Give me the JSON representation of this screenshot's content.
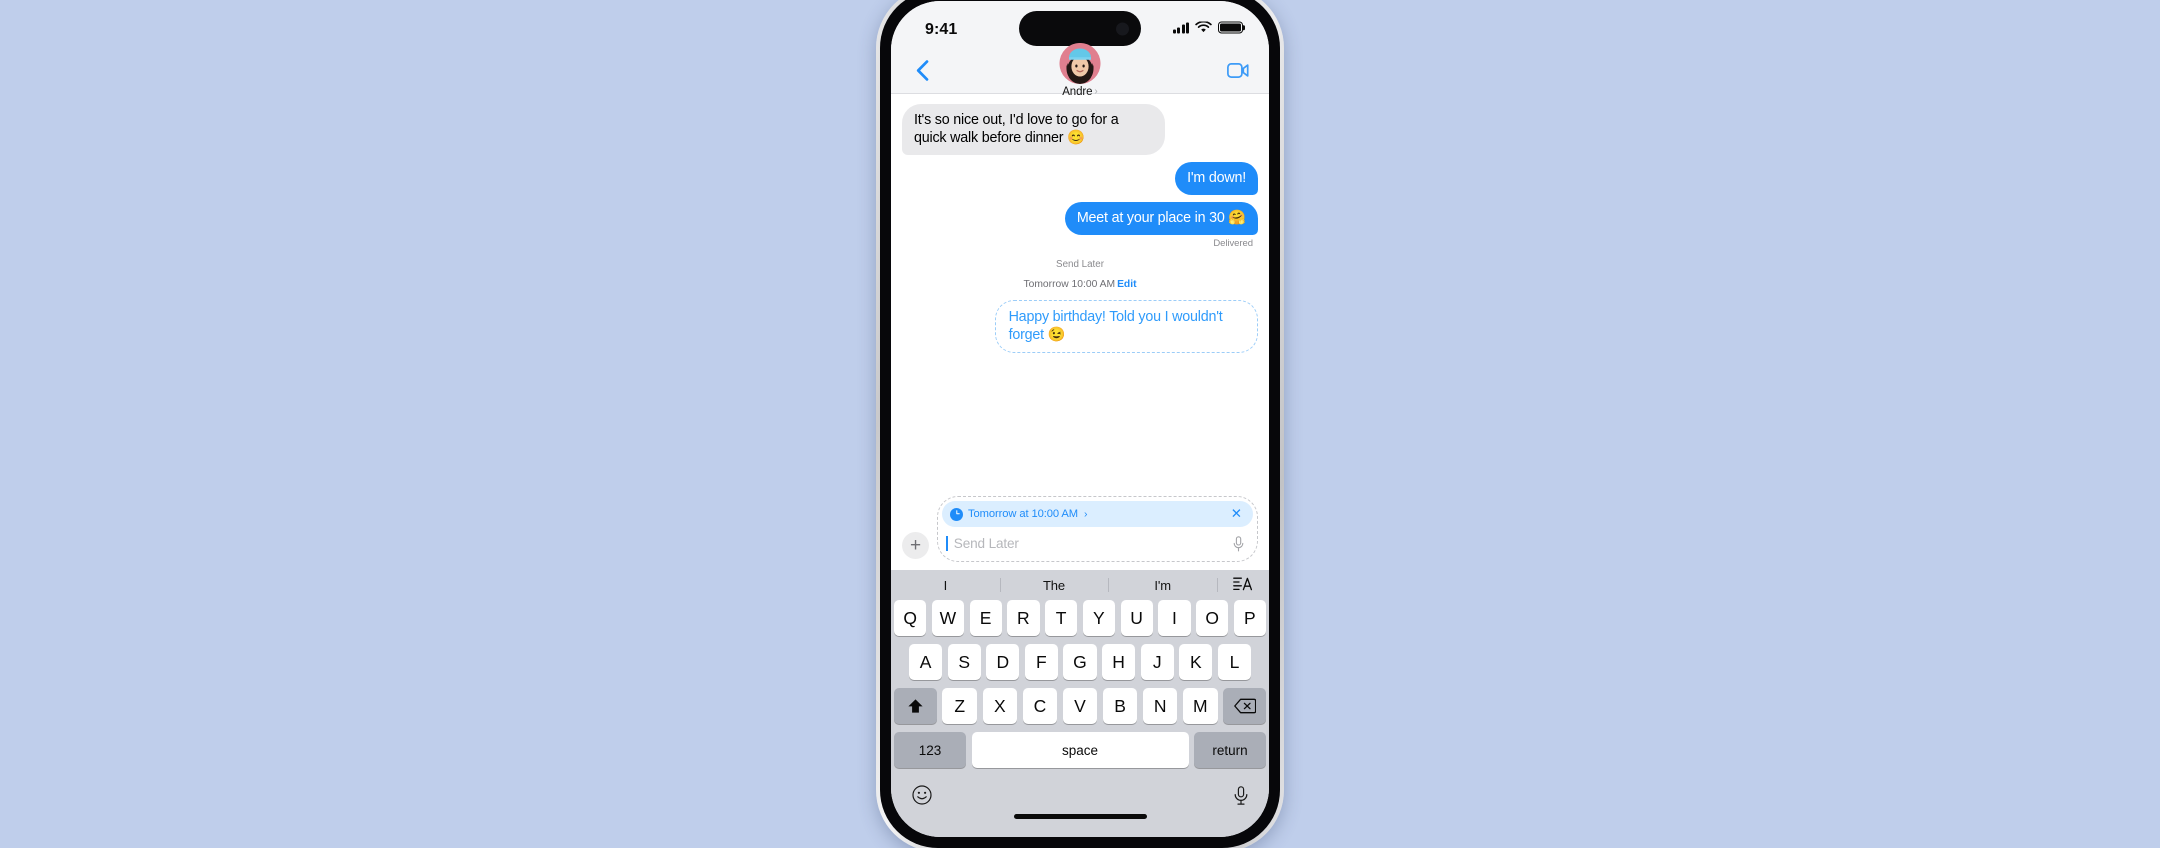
{
  "background_color": "#bfceeb",
  "accent_color": "#1f8cf9",
  "status_bar": {
    "time": "9:41",
    "signal_icon": "cellular-signal-icon",
    "wifi_icon": "wifi-icon",
    "battery_icon": "battery-icon"
  },
  "header": {
    "back_icon": "chevron-left-icon",
    "contact_name": "Andre",
    "contact_chevron": "›",
    "avatar_icon": "contact-avatar",
    "video_icon": "video-camera-icon"
  },
  "messages": [
    {
      "id": "msg-1",
      "direction": "in",
      "text": "It's so nice out, I'd love to go for a quick walk before dinner 😊"
    },
    {
      "id": "msg-2",
      "direction": "out",
      "text": "I'm down!"
    },
    {
      "id": "msg-3",
      "direction": "out",
      "text": "Meet at your place in 30 🤗"
    }
  ],
  "delivery_status": "Delivered",
  "send_later": {
    "title": "Send Later",
    "time": "Tomorrow 10:00 AM",
    "edit_label": "Edit",
    "scheduled_message": "Happy birthday! Told you I wouldn't forget 😉"
  },
  "composer": {
    "plus_icon": "plus-icon",
    "plus_label": "+",
    "chip": {
      "clock_icon": "clock-icon",
      "text": "Tomorrow at 10:00 AM",
      "chevron": "›",
      "close_label": "✕",
      "close_icon": "close-icon",
      "background": "#dbeeff"
    },
    "input_placeholder": "Send Later",
    "input_value": "",
    "mic_icon": "microphone-icon"
  },
  "keyboard": {
    "predictions": [
      "I",
      "The",
      "I'm"
    ],
    "format_icon": "text-format-icon",
    "row1": [
      "Q",
      "W",
      "E",
      "R",
      "T",
      "Y",
      "U",
      "I",
      "O",
      "P"
    ],
    "row2": [
      "A",
      "S",
      "D",
      "F",
      "G",
      "H",
      "J",
      "K",
      "L"
    ],
    "row3": [
      "Z",
      "X",
      "C",
      "V",
      "B",
      "N",
      "M"
    ],
    "shift_icon": "shift-icon",
    "backspace_icon": "backspace-icon",
    "numbers_label": "123",
    "space_label": "space",
    "return_label": "return",
    "emoji_icon": "emoji-icon",
    "dictation_icon": "dictation-microphone-icon"
  }
}
